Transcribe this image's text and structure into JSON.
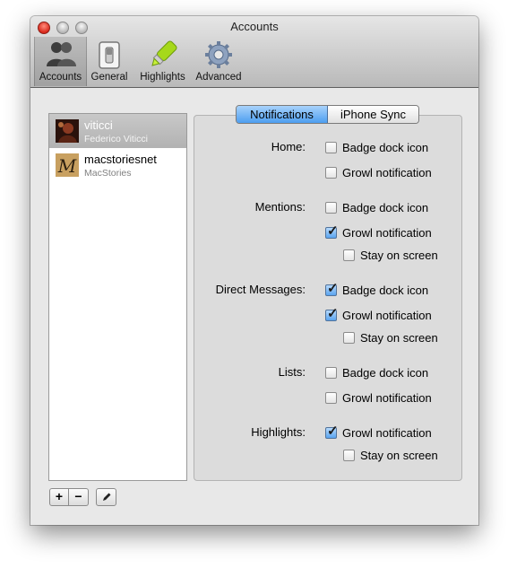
{
  "window": {
    "title": "Accounts"
  },
  "toolbar": {
    "items": [
      {
        "label": "Accounts",
        "icon": "accounts-icon",
        "selected": true
      },
      {
        "label": "General",
        "icon": "switch-icon",
        "selected": false
      },
      {
        "label": "Highlights",
        "icon": "highlighter-icon",
        "selected": false
      },
      {
        "label": "Advanced",
        "icon": "gear-icon",
        "selected": false
      }
    ]
  },
  "accounts": [
    {
      "name": "viticci",
      "subtitle": "Federico Viticci",
      "selected": true
    },
    {
      "name": "macstoriesnet",
      "subtitle": "MacStories",
      "selected": false
    }
  ],
  "list_buttons": {
    "add": "+",
    "remove": "−"
  },
  "tabs": [
    {
      "label": "Notifications",
      "active": true
    },
    {
      "label": "iPhone Sync",
      "active": false
    }
  ],
  "sections": {
    "home": {
      "label": "Home:",
      "badge": {
        "label": "Badge dock icon",
        "checked": false
      },
      "growl": {
        "label": "Growl notification",
        "checked": false
      }
    },
    "mentions": {
      "label": "Mentions:",
      "badge": {
        "label": "Badge dock icon",
        "checked": false
      },
      "growl": {
        "label": "Growl notification",
        "checked": true
      },
      "stay": {
        "label": "Stay on screen",
        "checked": false
      }
    },
    "direct_messages": {
      "label": "Direct Messages:",
      "badge": {
        "label": "Badge dock icon",
        "checked": true
      },
      "growl": {
        "label": "Growl notification",
        "checked": true
      },
      "stay": {
        "label": "Stay on screen",
        "checked": false
      }
    },
    "lists": {
      "label": "Lists:",
      "badge": {
        "label": "Badge dock icon",
        "checked": false
      },
      "growl": {
        "label": "Growl notification",
        "checked": false
      }
    },
    "highlights": {
      "label": "Highlights:",
      "growl": {
        "label": "Growl notification",
        "checked": true
      },
      "stay": {
        "label": "Stay on screen",
        "checked": false
      }
    }
  },
  "colors": {
    "selection_blue": "#5aa4ef",
    "close_red": "#d9281b",
    "highlighter_green": "#a6d81a"
  }
}
